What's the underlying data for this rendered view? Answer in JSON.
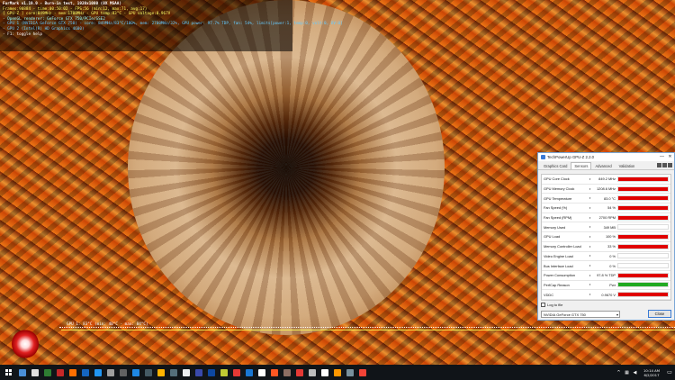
{
  "hud": {
    "line1": "FurMark v1.19.0 - Burn-in test, 1920x1080 (0X MSAA)",
    "line2": "Frames:90884 - time:00:50:02 - FPS:56 (min:12, max:71, avg:17)",
    "line3": "[ GPU-Z ] core:849MHz - mem:1708MHz - GPU temp:83°C - GPU voltage:0.967V",
    "line4": "- OpenGL renderer: GeForce GTX 750/PCIe/SSE2",
    "line5": "- GPU 1 (NVIDIA GeForce GTX 750) - core: 849MHz/83°C/100%, mem: 2700MHz/32%, GPU power: 97.7% TDP, fan: 54%, limits[power:1, temp:0, volt:0, OV:0]",
    "line6": "- GPU 2 (Intel(R) HD Graphics 4600)",
    "line7": "- F1: toggle help"
  },
  "graph": {
    "label": "GPU 1: 83°C (min: 40°C - max: 84°C)"
  },
  "gpuz": {
    "title": "TechPowerUp GPU-Z 2.2.0",
    "minimize": "—",
    "close": "✕",
    "tabs": [
      "Graphics Card",
      "Sensors",
      "Advanced",
      "Validation"
    ],
    "active_tab": "Sensors",
    "sensors": [
      {
        "name": "GPU Core Clock",
        "value": "849.2 MHz",
        "fill": 1.0,
        "color": "#e00000"
      },
      {
        "name": "GPU Memory Clock",
        "value": "1208.6 MHz",
        "fill": 1.0,
        "color": "#e00000"
      },
      {
        "name": "GPU Temperature",
        "value": "83.0 °C",
        "fill": 1.0,
        "color": "#e00000"
      },
      {
        "name": "Fan Speed (%)",
        "value": "54 %",
        "fill": 1.0,
        "color": "#e00000"
      },
      {
        "name": "Fan Speed (RPM)",
        "value": "2700 RPM",
        "fill": 1.0,
        "color": "#e00000"
      },
      {
        "name": "Memory Used",
        "value": "349 MB",
        "fill": 0.0,
        "color": "#e00000"
      },
      {
        "name": "GPU Load",
        "value": "100 %",
        "fill": 1.0,
        "color": "#e00000"
      },
      {
        "name": "Memory Controller Load",
        "value": "33 %",
        "fill": 1.0,
        "color": "#e00000"
      },
      {
        "name": "Video Engine Load",
        "value": "0 %",
        "fill": 0.0,
        "color": "#e00000"
      },
      {
        "name": "Bus Interface Load",
        "value": "0 %",
        "fill": 0.0,
        "color": "#e00000"
      },
      {
        "name": "Power Consumption",
        "value": "97.8 % TDP",
        "fill": 1.0,
        "color": "#e00000"
      },
      {
        "name": "PerfCap Reason",
        "value": "Pwr",
        "fill": 1.0,
        "color": "#22aa22"
      },
      {
        "name": "VDDC",
        "value": "0.9670 V",
        "fill": 1.0,
        "color": "#e00000"
      }
    ],
    "log_label": "Log to file",
    "gpu_select": "NVIDIA GeForce GTX 750",
    "close_button": "Close"
  },
  "taskbar": {
    "icons": [
      "#4a8fd8",
      "#e0e0e0",
      "#2e7d32",
      "#c62828",
      "#ff6f00",
      "#1565c0",
      "#2196f3",
      "#9e9e9e",
      "#616161",
      "#1e88e5",
      "#455a64",
      "#ffb300",
      "#546e7a",
      "#eceff1",
      "#3949ab",
      "#0d47a1",
      "#c0ca33",
      "#e53935",
      "#1976d2",
      "#ffffff",
      "#ff5722",
      "#8d6e63",
      "#e53935",
      "#bdbdbd",
      "#ffffff",
      "#ff9800",
      "#78909c",
      "#f44336"
    ],
    "time": "10:14 AM",
    "date": "6/2/2017"
  }
}
